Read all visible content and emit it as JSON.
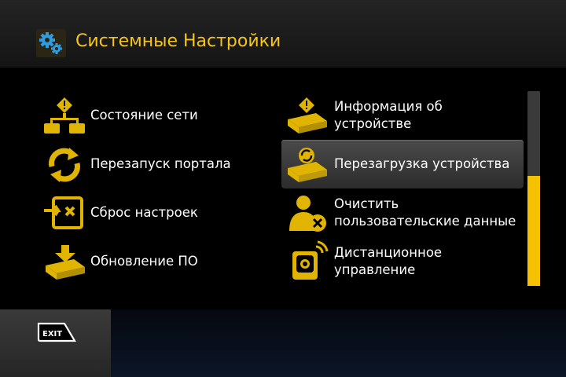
{
  "header": {
    "title": "Системные Настройки",
    "icon": "gears-icon"
  },
  "menu": {
    "left": [
      {
        "label": "Состояние сети",
        "icon": "network-status-icon"
      },
      {
        "label": "Перезапуск портала",
        "icon": "restart-arrows-icon"
      },
      {
        "label": "Сброс настроек",
        "icon": "reset-settings-icon"
      },
      {
        "label": "Обновление ПО",
        "icon": "software-update-icon"
      }
    ],
    "right": [
      {
        "label_line1": "Информация об",
        "label_line2": "устройстве",
        "icon": "device-info-icon"
      },
      {
        "label": "Перезагрузка устройства",
        "icon": "device-reboot-icon",
        "selected": true
      },
      {
        "label_line1": "Очистить",
        "label_line2": "пользовательские данные",
        "icon": "clear-user-data-icon"
      },
      {
        "label_line1": "Дистанционное",
        "label_line2": "управление",
        "icon": "remote-control-icon"
      }
    ]
  },
  "scrollbar": {
    "position_fraction": 0.44
  },
  "footer": {
    "exit_label": "EXIT",
    "exit_icon": "exit-key-icon"
  },
  "colors": {
    "accent": "#f5c518",
    "icon_yellow": "#e0b400",
    "text": "#ffffff"
  }
}
